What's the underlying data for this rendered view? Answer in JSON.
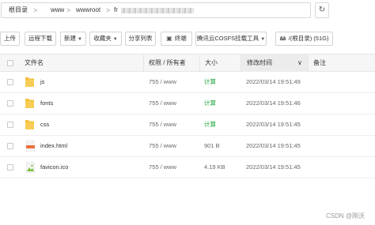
{
  "address": {
    "crumbs": [
      "根目录",
      "www",
      "wwwroot",
      "fr"
    ],
    "separator": ">",
    "refresh_icon": "refresh-icon"
  },
  "toolbar": {
    "upload": "上传",
    "remote_download": "远程下载",
    "new": "新建",
    "favorites": "收藏夹",
    "share_list": "分享列表",
    "terminal": "终端",
    "cosfs": "腾讯云COSFS挂载工具",
    "disk": "/(根目录) (51G)"
  },
  "columns": {
    "name": "文件名",
    "perm": "权限 / 所有者",
    "size": "大小",
    "mtime": "修改时间",
    "note": "备注"
  },
  "files": [
    {
      "name": "js",
      "type": "folder",
      "perm": "755 / www",
      "size": "计算",
      "mtime": "2022/03/14 19:51:49"
    },
    {
      "name": "fonts",
      "type": "folder",
      "perm": "755 / www",
      "size": "计算",
      "mtime": "2022/03/14 19:51:46"
    },
    {
      "name": "css",
      "type": "folder",
      "perm": "755 / www",
      "size": "计算",
      "mtime": "2022/03/14 19:51:45"
    },
    {
      "name": "index.html",
      "type": "html",
      "perm": "755 / www",
      "size": "901 B",
      "mtime": "2022/03/14 19:51:45"
    },
    {
      "name": "favicon.ico",
      "type": "image",
      "perm": "755 / www",
      "size": "4.19 KB",
      "mtime": "2022/03/14 19:51:45"
    }
  ],
  "watermark": "CSDN @刚沃",
  "colors": {
    "calc_link": "#20a53a",
    "folder": "#f5c03b",
    "header_bg": "#f6f6f6"
  }
}
